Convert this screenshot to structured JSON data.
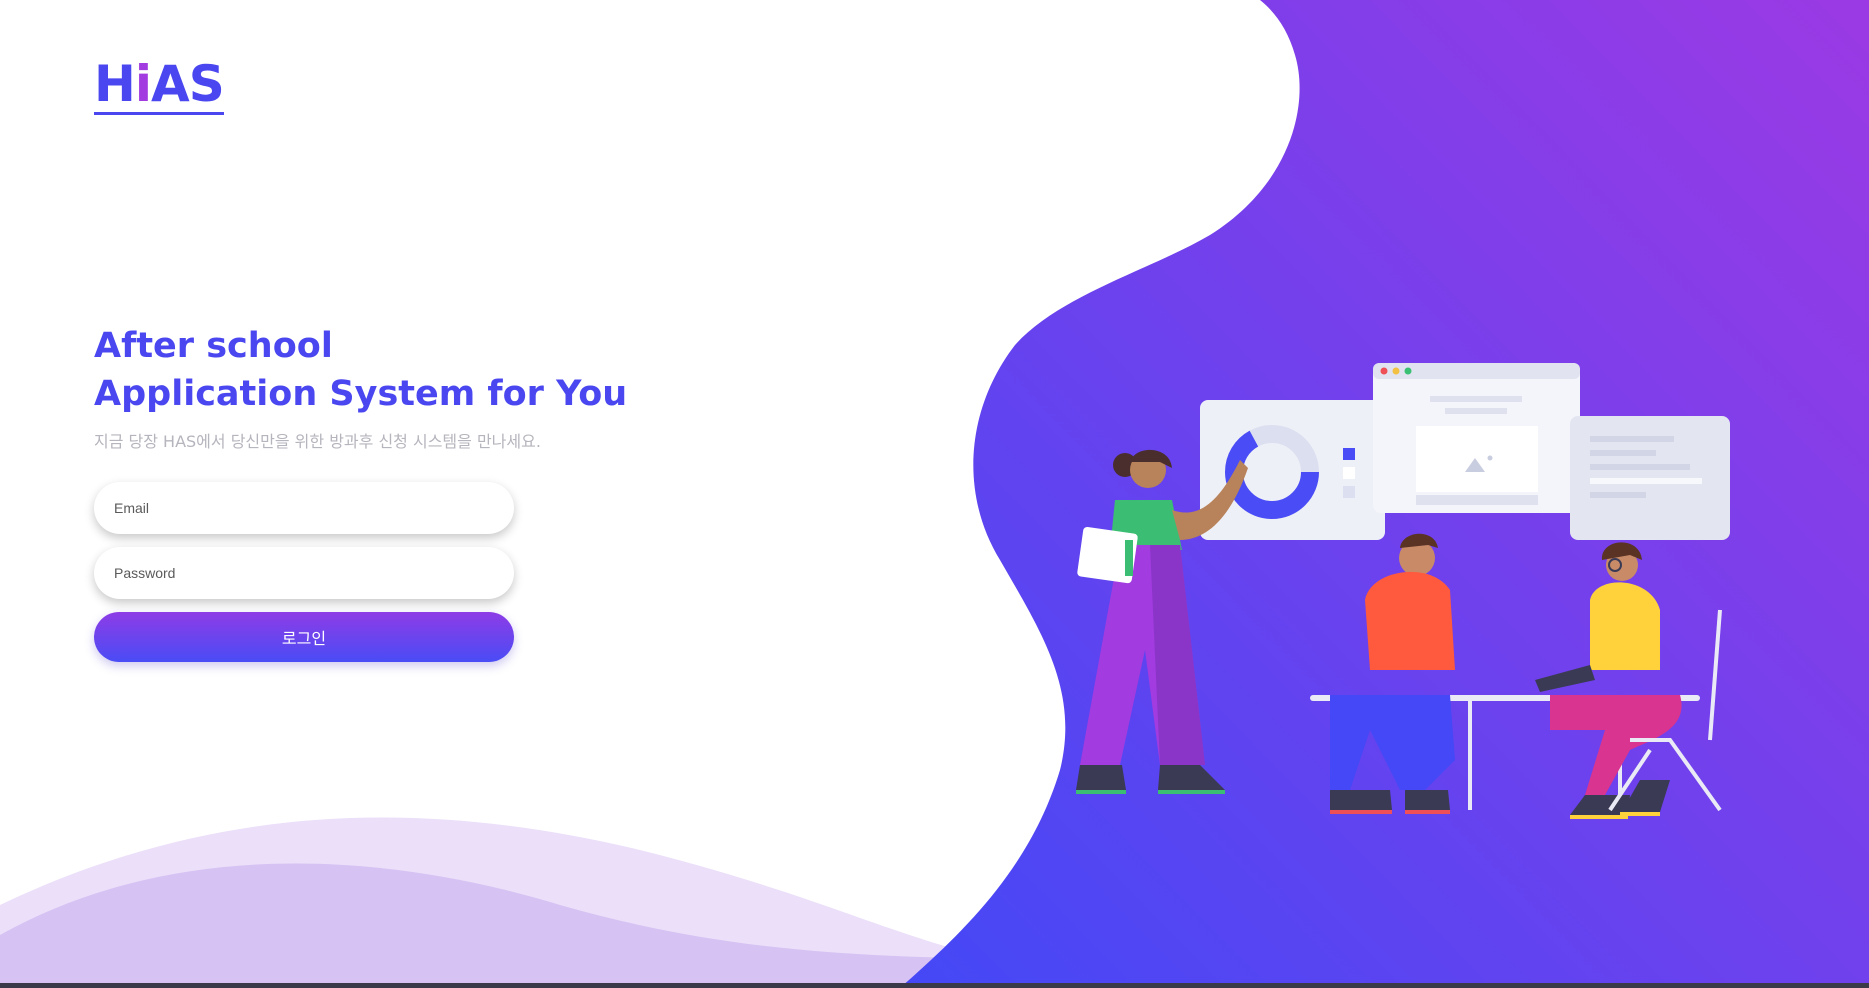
{
  "brand": {
    "logo_prefix": "H",
    "logo_accent": "i",
    "logo_suffix": "AS"
  },
  "hero": {
    "title_line1": "After school",
    "title_line2": "Application System for You",
    "subtitle": "지금 당장 HAS에서 당신만을 위한 방과후 신청 시스템을 만나세요."
  },
  "form": {
    "email_placeholder": "Email",
    "password_placeholder": "Password",
    "login_label": "로그인"
  },
  "colors": {
    "primary": "#4a47f0",
    "accent": "#a23be0",
    "gradient_start": "#8e3ce6",
    "gradient_end": "#4a4cf5",
    "subtitle_gray": "#b5b5bd",
    "wave_light": "#e6d9f8"
  },
  "illustration": {
    "icons": [
      "donut-chart-icon",
      "image-placeholder-icon",
      "browser-window-icon"
    ]
  }
}
